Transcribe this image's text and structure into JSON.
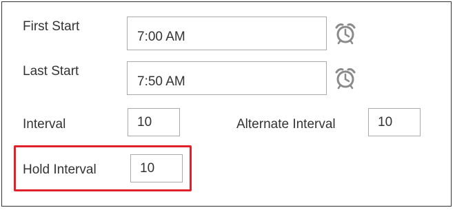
{
  "schedule": {
    "first_start": {
      "label": "First Start",
      "value": "7:00 AM",
      "icon": "alarm-clock-icon"
    },
    "last_start": {
      "label": "Last Start",
      "value": "7:50 AM",
      "icon": "alarm-clock-icon"
    },
    "interval": {
      "label": "Interval",
      "value": "10"
    },
    "alternate_interval": {
      "label": "Alternate Interval",
      "value": "10"
    },
    "hold_interval": {
      "label": "Hold Interval",
      "value": "10"
    }
  },
  "colors": {
    "highlight": "#e0202a",
    "icon": "#8a8a8a",
    "border": "#a9a9a9"
  }
}
